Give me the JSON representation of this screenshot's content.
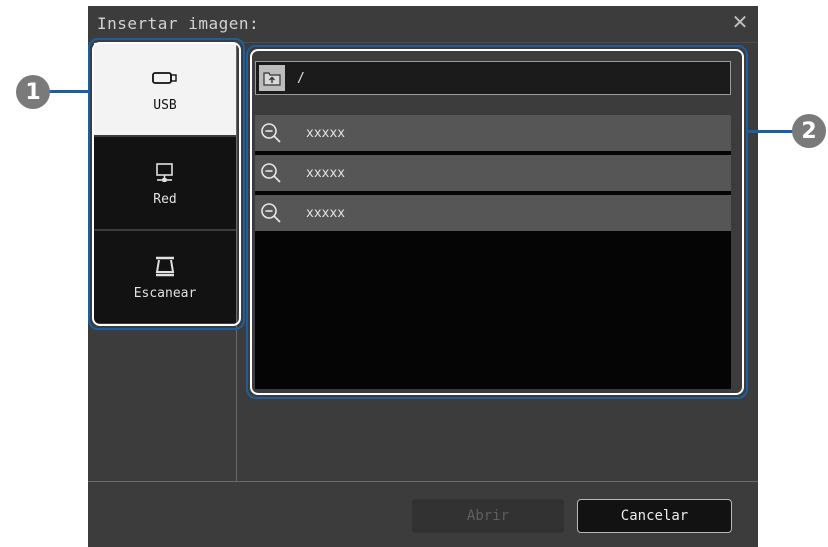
{
  "dialog": {
    "title": "Insertar imagen:",
    "close_icon": "close-icon"
  },
  "sources": [
    {
      "label": "USB",
      "icon": "usb-drive-icon",
      "selected": true
    },
    {
      "label": "Red",
      "icon": "network-icon",
      "selected": false
    },
    {
      "label": "Escanear",
      "icon": "scanner-icon",
      "selected": false
    }
  ],
  "browser": {
    "path": "/",
    "up_icon": "folder-up-icon",
    "files": [
      {
        "name": "xxxxx",
        "icon": "zoom-out-icon"
      },
      {
        "name": "xxxxx",
        "icon": "zoom-out-icon"
      },
      {
        "name": "xxxxx",
        "icon": "zoom-out-icon"
      }
    ]
  },
  "buttons": {
    "open": "Abrir",
    "cancel": "Cancelar"
  },
  "callouts": [
    "1",
    "2"
  ],
  "colors": {
    "callout_border": "#1a5fa0",
    "dialog_bg": "#3c3c3c"
  }
}
